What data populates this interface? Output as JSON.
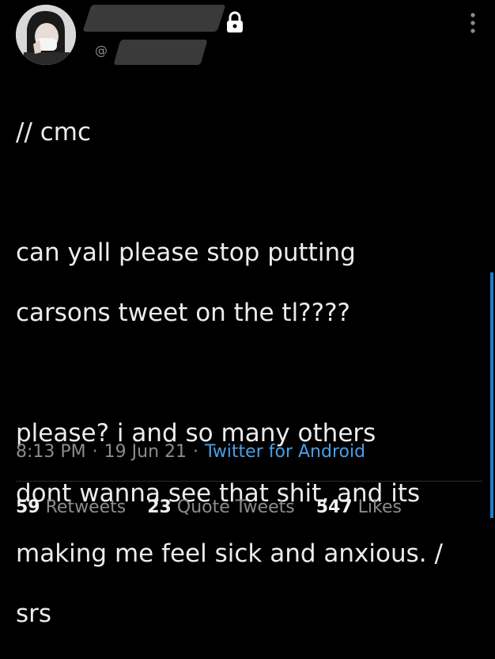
{
  "header": {
    "handle_prefix": "@",
    "avatar_icon": "profile-photo",
    "lock_icon": "lock-icon",
    "more_icon": "more-vertical-icon"
  },
  "tweet": {
    "lines": [
      "// cmc",
      "",
      "can yall please stop putting",
      "carsons tweet on the tl????",
      "",
      "please? i and so many others",
      "dont wanna see that shit, and its",
      "making me feel sick and anxious. /",
      "srs"
    ]
  },
  "meta": {
    "time": "8:13 PM",
    "separator": "·",
    "date": "19 Jun 21",
    "source": "Twitter for Android"
  },
  "stats": {
    "retweets_count": "59",
    "retweets_label": "Retweets",
    "quotes_count": "23",
    "quotes_label": "Quote Tweets",
    "likes_count": "547",
    "likes_label": "Likes"
  },
  "colors": {
    "background": "#000000",
    "text": "#ececec",
    "muted": "#8c8c8c",
    "link": "#4a9ee8"
  }
}
